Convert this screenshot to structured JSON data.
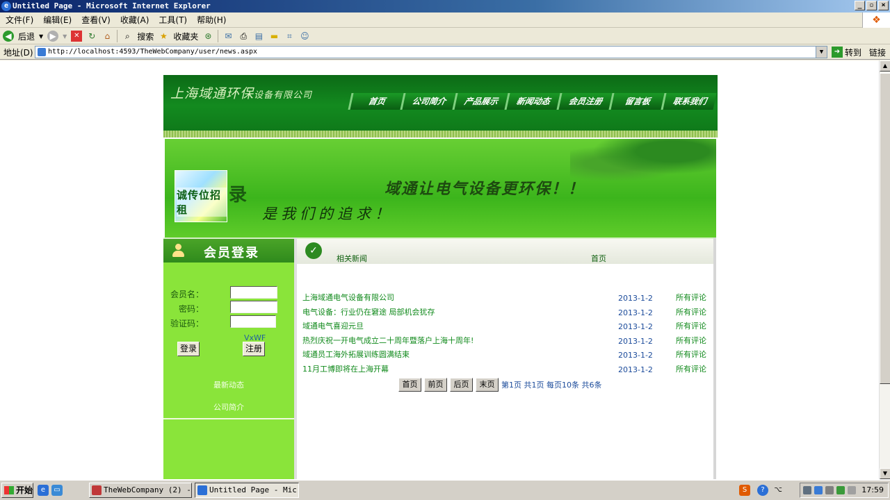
{
  "window": {
    "title": "Untitled Page - Microsoft Internet Explorer",
    "controls": {
      "minimize": "_",
      "maximize": "▫",
      "close": "×"
    }
  },
  "menu": [
    "文件(F)",
    "编辑(E)",
    "查看(V)",
    "收藏(A)",
    "工具(T)",
    "帮助(H)"
  ],
  "toolbar": {
    "back_label": "后退",
    "search_label": "搜索",
    "favorites_label": "收藏夹"
  },
  "address": {
    "label": "地址(D)",
    "url": "http://localhost:4593/TheWebCompany/user/news.aspx",
    "go_label": "转到",
    "links_label": "链接"
  },
  "site": {
    "logo_main": "上海域通环保",
    "logo_sub": "设备有限公司",
    "nav": [
      "首页",
      "公司简介",
      "产品展示",
      "新闻动态",
      "会员注册",
      "留言板",
      "联系我们"
    ],
    "banner": {
      "promo_text": "诚传位招租",
      "promo_extra": "录",
      "slogan1": "域通让电气设备更环保！！",
      "slogan2": "是我们的追求！"
    },
    "sidebar": {
      "title": "会员登录",
      "username_label": "会员名：",
      "password_label": "密码：",
      "captcha_label": "验证码：",
      "captcha_code": "VxWF",
      "login_button": "登录",
      "register_button": "注册",
      "link_latest": "最新动态",
      "link_about": "公司简介"
    },
    "main": {
      "crumb_title": "相关新闻",
      "crumb_home": "首页",
      "news": [
        {
          "title": "上海域通电气设备有限公司",
          "date": "2013-1-2",
          "comment": "所有评论"
        },
        {
          "title": "电气设备：行业仍在窘途 局部机会犹存",
          "date": "2013-1-2",
          "comment": "所有评论"
        },
        {
          "title": "域通电气喜迎元旦",
          "date": "2013-1-2",
          "comment": "所有评论"
        },
        {
          "title": "热烈庆祝一开电气成立二十周年暨落户上海十周年!",
          "date": "2013-1-2",
          "comment": "所有评论"
        },
        {
          "title": "域通员工海外拓展训练圆满结束",
          "date": "2013-1-2",
          "comment": "所有评论"
        },
        {
          "title": "11月工博即将在上海开幕",
          "date": "2013-1-2",
          "comment": "所有评论"
        }
      ],
      "pager": {
        "first": "首页",
        "prev": "前页",
        "next": "后页",
        "last": "末页",
        "info": "第1页  共1页  每页10条  共6条"
      }
    }
  },
  "taskbar": {
    "start_label": "开始",
    "tasks": [
      {
        "label": "TheWebCompany (2) -..."
      },
      {
        "label": "Untitled Page - Mic..."
      }
    ],
    "clock": "17:59"
  }
}
